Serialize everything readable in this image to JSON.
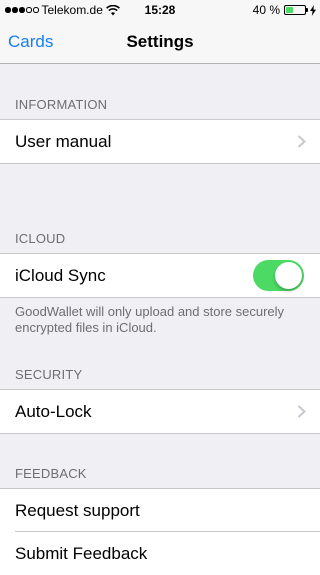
{
  "status_bar": {
    "carrier": "Telekom.de",
    "time": "15:28",
    "battery_text": "40 %",
    "signal_bars_filled": 3,
    "signal_bars_total": 5,
    "battery_level": 0.4,
    "battery_color": "#4cd964"
  },
  "nav": {
    "back_label": "Cards",
    "title": "Settings",
    "accent_color": "#157efb"
  },
  "sections": {
    "information": {
      "header": "INFORMATION",
      "items": [
        {
          "label": "User manual",
          "icon": "chevron-right-icon"
        }
      ]
    },
    "icloud": {
      "header": "ICLOUD",
      "items": [
        {
          "label": "iCloud Sync",
          "toggle_on": true
        }
      ],
      "footer": "GoodWallet will only upload and store securely encrypted files in iCloud."
    },
    "security": {
      "header": "SECURITY",
      "items": [
        {
          "label": "Auto-Lock",
          "icon": "chevron-right-icon"
        }
      ]
    },
    "feedback": {
      "header": "FEEDBACK",
      "items": [
        {
          "label": "Request support"
        },
        {
          "label": "Submit Feedback"
        }
      ]
    }
  }
}
